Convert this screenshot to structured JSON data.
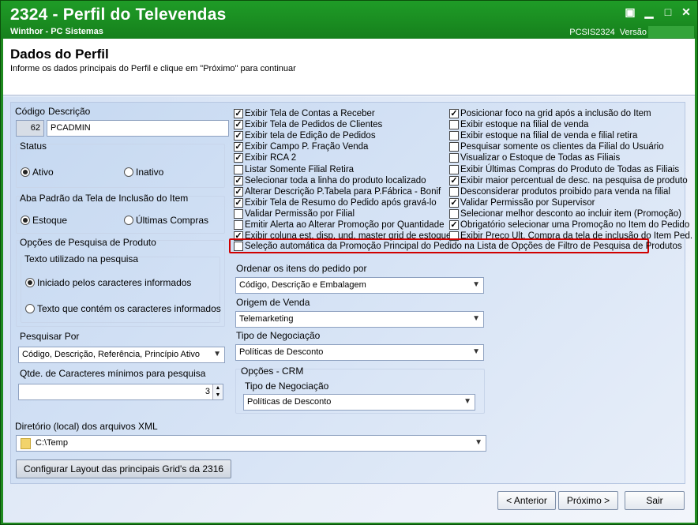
{
  "window": {
    "title": "2324 - Perfil do Televendas",
    "subtitle": "Winthor - PC Sistemas",
    "routine": "PCSIS2324",
    "version_label": "Versão",
    "controls": [
      "▣",
      "▁",
      "□",
      "✕"
    ]
  },
  "header": {
    "title": "Dados do Perfil",
    "subtitle": "Informe os dados principais do Perfil e clique em \"Próximo\" para continuar"
  },
  "left": {
    "codigo_label": "Código",
    "descricao_label": "Descrição",
    "codigo_value": "62",
    "descricao_value": "PCADMIN",
    "status": {
      "title": "Status",
      "options": [
        "Ativo",
        "Inativo"
      ],
      "selected": "Ativo"
    },
    "aba": {
      "title": "Aba Padrão da Tela de Inclusão do Item",
      "options": [
        "Estoque",
        "Últimas Compras"
      ],
      "selected": "Estoque"
    },
    "pesquisa": {
      "title": "Opções de Pesquisa de Produto",
      "texto_title": "Texto utilizado na pesquisa",
      "options": [
        "Iniciado pelos caracteres informados",
        "Texto que contém os caracteres informados"
      ],
      "selected": "Iniciado pelos caracteres informados"
    },
    "pesquisar_por_label": "Pesquisar Por",
    "pesquisar_por_value": "Código, Descrição, Referência, Princípio Ativo",
    "qtde_label": "Qtde. de Caracteres mínimos para pesquisa",
    "qtde_value": "3",
    "diretorio_label": "Diretório (local) dos arquivos XML",
    "diretorio_value": "C:\\Temp",
    "config_button": "Configurar Layout das principais Grid's da 2316"
  },
  "checks_col1": [
    {
      "label": "Exibir Tela de Contas a Receber",
      "checked": true
    },
    {
      "label": "Exibir Tela de Pedidos de Clientes",
      "checked": true
    },
    {
      "label": "Exibir tela de Edição de Pedidos",
      "checked": true
    },
    {
      "label": "Exibir Campo P. Fração Venda",
      "checked": true
    },
    {
      "label": "Exibir RCA 2",
      "checked": true
    },
    {
      "label": "Listar Somente Filial Retira",
      "checked": false
    },
    {
      "label": "Selecionar toda a linha do produto localizado",
      "checked": true
    },
    {
      "label": "Alterar Descrição P.Tabela para P.Fábrica - Bonif",
      "checked": true
    },
    {
      "label": "Exibir Tela de Resumo do Pedido após gravá-lo",
      "checked": true
    },
    {
      "label": "Validar Permissão por Filial",
      "checked": false
    },
    {
      "label": "Emitir Alerta ao Alterar Promoção por Quantidade",
      "checked": false
    },
    {
      "label": "Exibir coluna est. disp. und. master grid de estoque",
      "checked": true
    }
  ],
  "checks_col2": [
    {
      "label": "Posicionar foco na grid após a inclusão do Item",
      "checked": true
    },
    {
      "label": "Exibir estoque na filial de venda",
      "checked": false
    },
    {
      "label": "Exibir estoque na filial de venda e filial retira",
      "checked": false
    },
    {
      "label": "Pesquisar somente os clientes da Filial do Usuário",
      "checked": false
    },
    {
      "label": "Visualizar o Estoque de Todas as Filiais",
      "checked": false
    },
    {
      "label": "Exibir Últimas Compras do Produto de Todas as Filiais",
      "checked": false
    },
    {
      "label": "Exibir maior percentual de desc. na pesquisa de produto",
      "checked": true
    },
    {
      "label": "Desconsiderar produtos proibido para venda na filial",
      "checked": false
    },
    {
      "label": "Validar Permissão por Supervisor",
      "checked": true
    },
    {
      "label": "Selecionar melhor desconto ao incluir item (Promoção)",
      "checked": false
    },
    {
      "label": "Obrigatório selecionar uma Promoção no Item do Pedido",
      "checked": true
    },
    {
      "label": "Exibir Preço Ult. Compra da tela de inclusão do Item Ped.",
      "checked": false
    }
  ],
  "highlight_check": {
    "label": "Seleção automática da Promoção Principal do Pedido na Lista de Opções de Filtro de Pesquisa de Produtos",
    "checked": false
  },
  "ordenar": {
    "label": "Ordenar os itens do pedido por",
    "value": "Código, Descrição e Embalagem"
  },
  "origem": {
    "label": "Origem de Venda",
    "value": "Telemarketing"
  },
  "tipo_neg": {
    "label": "Tipo de Negociação",
    "value": "Políticas de Desconto"
  },
  "crm": {
    "title": "Opções - CRM",
    "tipo_label": "Tipo de Negociação",
    "tipo_value": "Políticas de Desconto"
  },
  "footer": {
    "anterior": "< Anterior",
    "proximo": "Próximo >",
    "sair": "Sair"
  },
  "colors": {
    "titlebar": "#1f8a1f",
    "highlight": "#d00000"
  }
}
